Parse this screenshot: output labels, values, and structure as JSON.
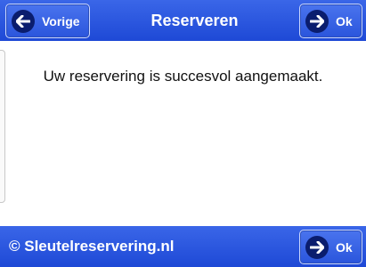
{
  "header": {
    "title": "Reserveren",
    "back_label": "Vorige",
    "ok_label": "Ok"
  },
  "main": {
    "message": "Uw reservering is succesvol aangemaakt."
  },
  "footer": {
    "copyright": "© Sleutelreservering.nl",
    "ok_label": "Ok"
  },
  "icons": {
    "back": "arrow-left-icon",
    "forward": "arrow-right-icon"
  },
  "colors": {
    "bar_blue": "#2a55dc",
    "icon_circle": "#0a1d6e"
  }
}
